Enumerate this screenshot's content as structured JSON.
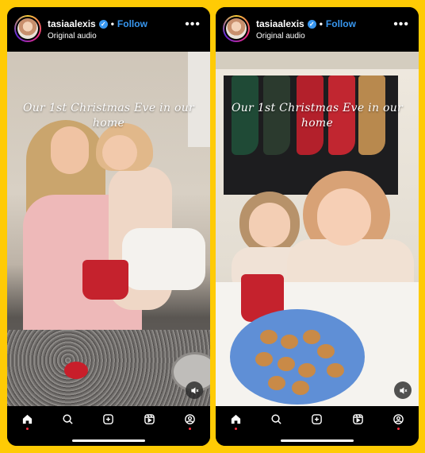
{
  "posts": [
    {
      "username": "tasiaalexis",
      "separator": "•",
      "follow_label": "Follow",
      "audio": "Original audio",
      "more": "•••",
      "caption": "Our 1st Christmas Eve in our home"
    },
    {
      "username": "tasiaalexis",
      "separator": "•",
      "follow_label": "Follow",
      "audio": "Original audio",
      "more": "•••",
      "caption": "Our 1st Christmas Eve in our home"
    }
  ],
  "nav": [
    "home-icon",
    "search-icon",
    "create-icon",
    "reels-icon",
    "profile-icon"
  ],
  "colors": {
    "background": "#FFCB05",
    "accent": "#3897f0",
    "notification": "#ff3040"
  }
}
